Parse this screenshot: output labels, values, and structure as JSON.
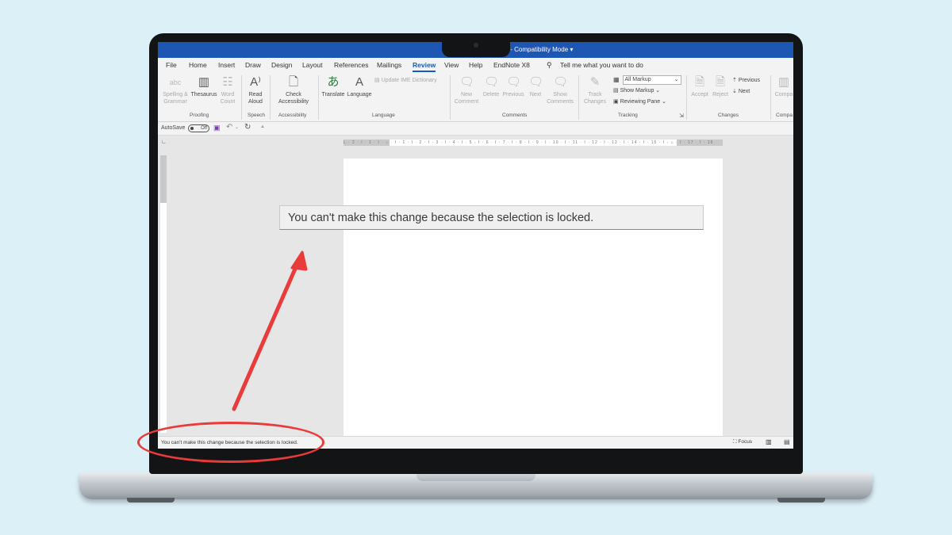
{
  "window": {
    "title_fragment": "x  -  Compatibility Mode  ▾"
  },
  "menu": {
    "tabs": [
      "File",
      "Home",
      "Insert",
      "Draw",
      "Design",
      "Layout",
      "References",
      "Mailings",
      "Review",
      "View",
      "Help",
      "EndNote X8"
    ],
    "active_tab": "Review",
    "tell_me": "Tell me what you want to do"
  },
  "ribbon": {
    "proofing": {
      "spelling": "Spelling &",
      "spelling2": "Grammar",
      "thesaurus": "Thesaurus",
      "word": "Word",
      "count": "Count",
      "group": "Proofing"
    },
    "speech": {
      "read": "Read",
      "aloud": "Aloud",
      "group": "Speech"
    },
    "accessibility": {
      "check": "Check",
      "access": "Accessibility",
      "group": "Accessibility"
    },
    "language": {
      "translate": "Translate",
      "language": "Language",
      "update_ime": "Update IME Dictionary",
      "group": "Language"
    },
    "comments": {
      "new": "New",
      "new2": "Comment",
      "delete": "Delete",
      "previous": "Previous",
      "next": "Next",
      "show": "Show",
      "show2": "Comments",
      "group": "Comments"
    },
    "tracking": {
      "track": "Track",
      "changes": "Changes",
      "markup_select": "All Markup",
      "show_markup": "Show Markup",
      "reviewing_pane": "Reviewing Pane",
      "group": "Tracking"
    },
    "changes": {
      "accept": "Accept",
      "reject": "Reject",
      "previous": "Previous",
      "next": "Next",
      "group": "Changes"
    },
    "compare": {
      "label": "Compa",
      "group": "Compa"
    }
  },
  "qat": {
    "autosave": "AutoSave",
    "toggle": "Off"
  },
  "ruler": {
    "text": "L · 2 · I · 1 · I · ⌂ · I · 1 · I · 2 · I · 3 · I · 4 · I · 5 · I · 6 · I · 7 · I · 8 · I · 9 · I · 10 · I · 11 · I · 12 · I · 13 · I · 14 · I · 15 · I · ⌂ · I · 17 · I · 18"
  },
  "tooltip": {
    "message": "You can't make this change because the selection is locked."
  },
  "status": {
    "message": "You can't make this change because the selection is locked.",
    "focus": "Focus"
  },
  "colors": {
    "title_bar": "#1e57b3",
    "accent": "#185abd",
    "annotation": "#ea3b3b",
    "background": "#dcf0f7"
  }
}
